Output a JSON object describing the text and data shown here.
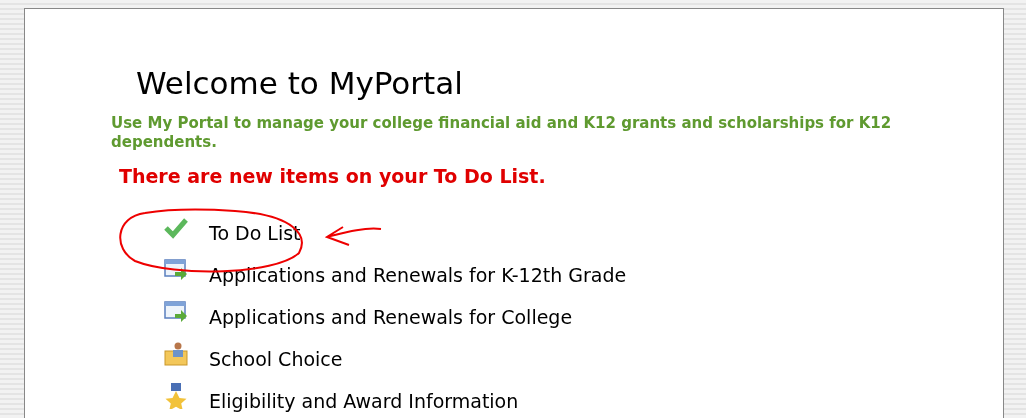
{
  "title": "Welcome to MyPortal",
  "intro": "Use My Portal to manage your college financial aid and K12 grants and scholarships for K12 dependents.",
  "alert": "There are new items on your To Do List.",
  "menu": [
    {
      "kind": "todo",
      "label": "To Do List"
    },
    {
      "kind": "application",
      "label": "Applications and Renewals for K-12th Grade"
    },
    {
      "kind": "application",
      "label": "Applications and Renewals for College"
    },
    {
      "kind": "school",
      "label": "School Choice"
    },
    {
      "kind": "award",
      "label": "Eligibility and Award Information"
    }
  ]
}
